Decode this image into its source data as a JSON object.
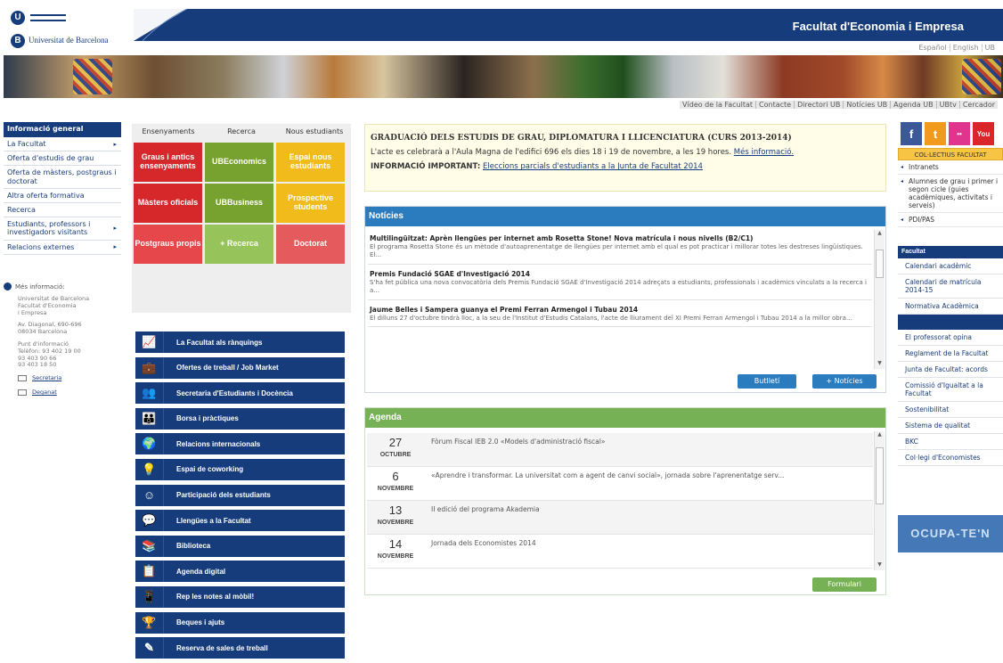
{
  "header": {
    "logo_text": "Universitat de Barcelona",
    "faculty_title": "Facultat d'Economia i Empresa",
    "languages": [
      "Español",
      "English",
      "UB"
    ],
    "top_links": [
      "Vídeo de la Facultat",
      "Contacte",
      "Directori UB",
      "Notícies UB",
      "Agenda UB",
      "UBtv",
      "Cercador"
    ]
  },
  "left_nav": {
    "heading": "Informació general",
    "items": [
      {
        "label": "La Facultat",
        "arrow": true
      },
      {
        "label": "Oferta d'estudis de grau",
        "arrow": false
      },
      {
        "label": "Oferta de màsters, postgraus i doctorat",
        "arrow": false
      },
      {
        "label": "Altra oferta formativa",
        "arrow": false
      },
      {
        "label": "Recerca",
        "arrow": false
      },
      {
        "label": "Estudiants, professors i investigadors visitants",
        "arrow": true
      },
      {
        "label": "Relacions externes",
        "arrow": true
      }
    ]
  },
  "more_info": {
    "title": "Més informació:",
    "org": "Universitat de Barcelona\nFacultat d'Economia\ni Empresa",
    "address": "Av. Diagonal, 690-696\n08034 Barcelona",
    "contact": "Punt d'informació\nTelèfon: 93 402 19 00\n93 403 90 66\n93 403 18 50",
    "links": [
      "Secretaria",
      "Deganat"
    ]
  },
  "studies": {
    "tabs": [
      "Ensenyaments",
      "Recerca",
      "Nous estudiants"
    ],
    "tiles": [
      {
        "label": "Graus i antics ensenyaments",
        "color": "#d6282b"
      },
      {
        "label": "UBEconomics",
        "color": "#78a22f"
      },
      {
        "label": "Espai nous estudiants",
        "color": "#f2bb1c"
      },
      {
        "label": "Màsters oficials",
        "color": "#d6282b"
      },
      {
        "label": "UBBusiness",
        "color": "#78a22f"
      },
      {
        "label": "Prospective students",
        "color": "#f2bb1c"
      },
      {
        "label": "Postgraus propis",
        "color": "#e5474a"
      },
      {
        "label": "+ Recerca",
        "color": "#96c45a"
      },
      {
        "label": "Doctorat",
        "color": "#e55a5c"
      }
    ]
  },
  "services": [
    {
      "label": "La Facultat als rànquings",
      "icon": "chart-icon",
      "glyph": "📈"
    },
    {
      "label": "Ofertes de treball / Job Market",
      "icon": "briefcase-icon",
      "glyph": "💼"
    },
    {
      "label": "Secretaria d'Estudiants i Docència",
      "icon": "people-desk-icon",
      "glyph": "👥"
    },
    {
      "label": "Borsa i pràctiques",
      "icon": "group-icon",
      "glyph": "👪"
    },
    {
      "label": "Relacions internacionals",
      "icon": "globe-icon",
      "glyph": "🌍"
    },
    {
      "label": "Espai de coworking",
      "icon": "lightbulb-icon",
      "glyph": "💡"
    },
    {
      "label": "Participació dels estudiants",
      "icon": "participation-icon",
      "glyph": "☺"
    },
    {
      "label": "Llengües a la Facultat",
      "icon": "speech-icon",
      "glyph": "💬"
    },
    {
      "label": "Biblioteca",
      "icon": "book-icon",
      "glyph": "📚"
    },
    {
      "label": "Agenda digital",
      "icon": "agenda-icon",
      "glyph": "📋"
    },
    {
      "label": "Rep les notes al mòbil!",
      "icon": "mobile-icon",
      "glyph": "📱"
    },
    {
      "label": "Beques i ajuts",
      "icon": "trophy-icon",
      "glyph": "🏆"
    },
    {
      "label": "Reserva de sales de treball",
      "icon": "pencil-icon",
      "glyph": "✎"
    }
  ],
  "announcement": {
    "title": "GRADUACIÓ DELS ESTUDIS DE GRAU, DIPLOMATURA I LLICENCIATURA (CURS 2013-2014)",
    "line1": "L'acte es celebrarà a l'Aula Magna de l'edifici 696 els dies 18 i 19 de novembre, a les 19 hores.",
    "line1_link": "Més informació.",
    "line2_label": "INFORMACIÓ IMPORTANT:",
    "line2_link": "Eleccions parcials d'estudiants a la Junta de Facultat 2014"
  },
  "news": {
    "heading": "Notícies",
    "items": [
      {
        "title": "Multilingüitzat: Aprèn llengües per internet amb Rosetta Stone! Nova matrícula i nous nivells (B2/C1)",
        "desc": "El programa Rosetta Stone és un mètode d'autoaprenentatge de llengües per internet amb el qual es pot practicar i millorar totes les destreses lingüístiques. El..."
      },
      {
        "title": "Premis Fundació SGAE d'Investigació 2014",
        "desc": "S'ha fet pública una nova convocatòria dels Premis Fundació SGAE d'Investigació 2014 adreçats a estudiants, professionals i acadèmics vinculats a la recerca i a..."
      },
      {
        "title": "Jaume Belles i Sampera guanya el Premi Ferran Armengol i Tubau 2014",
        "desc": "El dilluns 27 d'octubre tindrà lloc, a la seu de l'Institut d'Estudis Catalans, l'acte de lliurament del XI Premi Ferran Armengol i Tubau 2014 a la millor obra..."
      }
    ],
    "buttons": [
      "Butlletí",
      "+ Notícies"
    ]
  },
  "agenda": {
    "heading": "Agenda",
    "items": [
      {
        "day": "27",
        "month": "OCTUBRE",
        "text": "Fòrum Fiscal IEB 2.0 «Models d'administració fiscal»"
      },
      {
        "day": "6",
        "month": "NOVEMBRE",
        "text": "«Aprendre i transformar. La universitat com a agent de canvi social», jornada sobre l'aprenentatge serv..."
      },
      {
        "day": "13",
        "month": "NOVEMBRE",
        "text": "II edició del programa Akademia"
      },
      {
        "day": "14",
        "month": "NOVEMBRE",
        "text": "Jornada dels Economistes 2014"
      }
    ],
    "button": "Formulari"
  },
  "right": {
    "social": [
      {
        "name": "facebook-icon",
        "glyph": "f",
        "color": "#3b5998"
      },
      {
        "name": "twitter-icon",
        "glyph": "t",
        "color": "#f29a1e"
      },
      {
        "name": "flickr-icon",
        "glyph": "••",
        "color": "#e0358f"
      },
      {
        "name": "youtube-icon",
        "glyph": "You",
        "color": "#d8262a"
      }
    ],
    "colectius_heading": "COL·LECTIUS FACULTAT",
    "colectius": [
      "Intranets",
      "Alumnes de grau i primer i segon cicle (guies acadèmiques, activitats i serveis)",
      "PDI/PAS"
    ],
    "facultat_heading": "Facultat",
    "facultat_links": [
      "Calendari acadèmic",
      "Calendari de matrícula 2014-15",
      "Normativa Acadèmica"
    ],
    "other_links": [
      "El professorat opina",
      "Reglament de la Facultat",
      "Junta de Facultat: acords",
      "Comissió d'Igualtat a la Facultat",
      "Sostenibilitat",
      "Sistema de qualitat",
      "BKC",
      "Col·legi d'Economistes"
    ],
    "banner": "OCUPA-TE'N"
  }
}
